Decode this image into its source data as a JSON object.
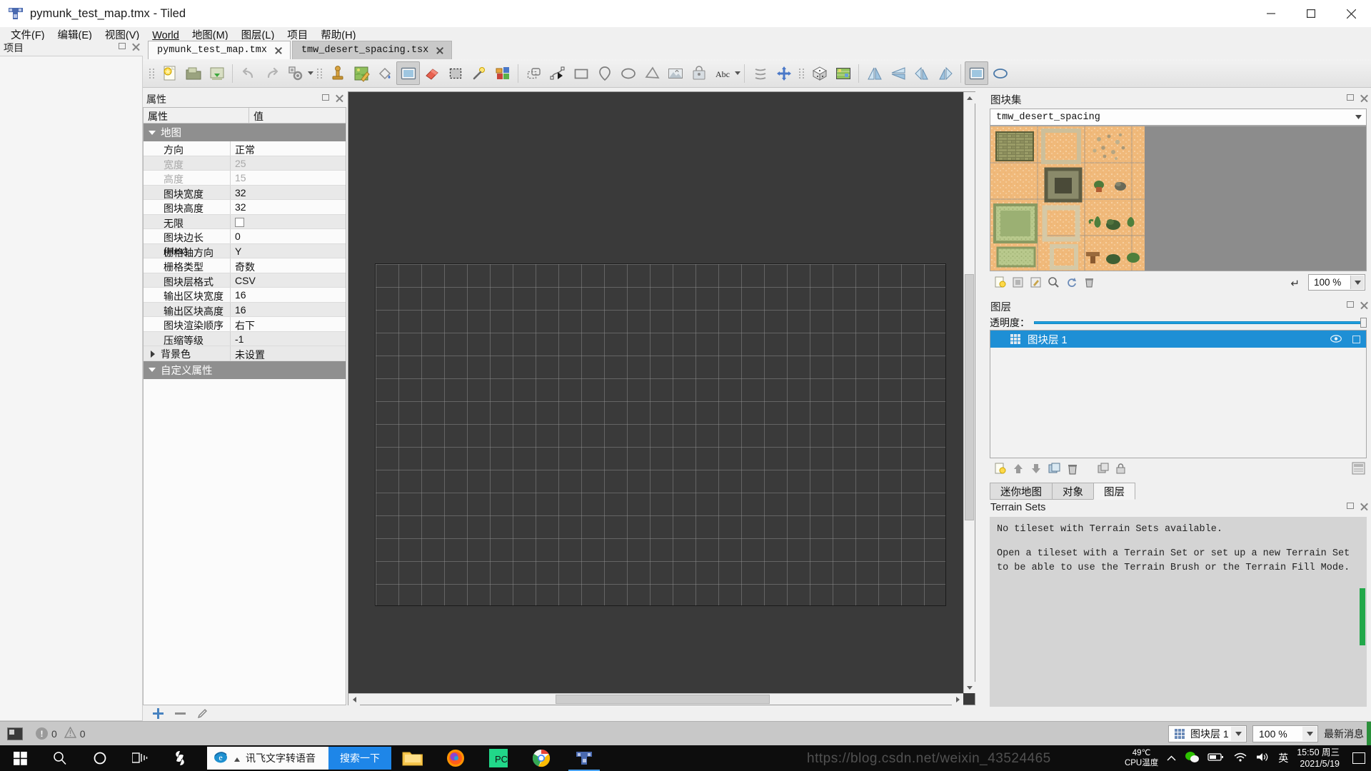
{
  "window": {
    "title": "pymunk_test_map.tmx - Tiled",
    "app_icon": "tiled-logo-icon",
    "minimize": "—",
    "maximize": "□",
    "close": "✕"
  },
  "menubar": {
    "items": [
      {
        "label": "文件(F)",
        "mnemonic": "F"
      },
      {
        "label": "编辑(E)",
        "mnemonic": "E"
      },
      {
        "label": "视图(V)",
        "mnemonic": "V"
      },
      {
        "label": "World",
        "mnemonic": "W"
      },
      {
        "label": "地图(M)",
        "mnemonic": "M"
      },
      {
        "label": "图层(L)",
        "mnemonic": "L"
      },
      {
        "label": "项目",
        "mnemonic": ""
      },
      {
        "label": "帮助(H)",
        "mnemonic": "H"
      }
    ]
  },
  "project_dock": {
    "title": "项目"
  },
  "tabs": [
    {
      "label": "pymunk_test_map.tmx",
      "active": true
    },
    {
      "label": "tmw_desert_spacing.tsx",
      "active": false
    }
  ],
  "toolbar": {
    "buttons": [
      {
        "name": "new-map-button",
        "icon": "new-file-icon"
      },
      {
        "name": "open-file-button",
        "icon": "open-folder-icon"
      },
      {
        "name": "save-file-button",
        "icon": "save-disk-icon"
      },
      {
        "name": "undo-button",
        "icon": "undo-arrow-icon"
      },
      {
        "name": "redo-button",
        "icon": "redo-arrow-icon"
      },
      {
        "name": "object-types-button",
        "icon": "gear-objects-icon"
      },
      {
        "name": "stamp-brush-button",
        "icon": "stamp-icon"
      },
      {
        "name": "terrain-brush-button",
        "icon": "map-pencil-icon"
      },
      {
        "name": "bucket-fill-button",
        "icon": "paint-bucket-icon"
      },
      {
        "name": "rectangle-select-button",
        "icon": "rectangle-select-icon"
      },
      {
        "name": "eraser-button",
        "icon": "eraser-icon"
      },
      {
        "name": "select-same-tile-button",
        "icon": "dashed-rect-icon"
      },
      {
        "name": "magic-wand-button",
        "icon": "magic-wand-icon"
      },
      {
        "name": "shape-fill-button",
        "icon": "shape-fill-icon"
      },
      {
        "name": "select-objects-button",
        "icon": "object-select-icon"
      },
      {
        "name": "edit-polygons-button",
        "icon": "polygon-edit-icon"
      },
      {
        "name": "insert-rectangle-button",
        "icon": "rectangle-icon"
      },
      {
        "name": "insert-point-button",
        "icon": "point-pin-icon"
      },
      {
        "name": "insert-ellipse-button",
        "icon": "ellipse-icon"
      },
      {
        "name": "insert-polygon-button",
        "icon": "polygon-icon"
      },
      {
        "name": "insert-tile-button",
        "icon": "image-tile-icon"
      },
      {
        "name": "insert-template-button",
        "icon": "template-icon"
      },
      {
        "name": "insert-text-button",
        "icon": "text-abc-icon"
      },
      {
        "name": "random-mode-button",
        "icon": "dice-icon"
      },
      {
        "name": "pan-tool-button",
        "icon": "move-cross-icon"
      },
      {
        "name": "dice-random-button",
        "icon": "dice-3d-icon"
      },
      {
        "name": "minimap-button",
        "icon": "minimap-icon"
      },
      {
        "name": "flip-horizontal-button",
        "icon": "flip-horizontal-icon"
      },
      {
        "name": "flip-vertical-button",
        "icon": "flip-vertical-icon"
      },
      {
        "name": "rotate-left-button",
        "icon": "rotate-left-icon"
      },
      {
        "name": "rotate-right-button",
        "icon": "rotate-right-icon"
      },
      {
        "name": "highlight-layer-button",
        "icon": "highlight-layer-icon"
      },
      {
        "name": "show-grid-button",
        "icon": "ellipse-outline-icon"
      }
    ]
  },
  "properties": {
    "dock_title": "属性",
    "col_key": "属性",
    "col_value": "值",
    "group_map": "地图",
    "group_custom": "自定义属性",
    "rows": [
      {
        "key": "方向",
        "value": "正常",
        "dim": false,
        "type": "text"
      },
      {
        "key": "宽度",
        "value": "25",
        "dim": true,
        "type": "text"
      },
      {
        "key": "高度",
        "value": "15",
        "dim": true,
        "type": "text"
      },
      {
        "key": "图块宽度",
        "value": "32",
        "dim": false,
        "type": "text"
      },
      {
        "key": "图块高度",
        "value": "32",
        "dim": false,
        "type": "text"
      },
      {
        "key": "无限",
        "value": "",
        "dim": false,
        "type": "checkbox",
        "checked": false
      },
      {
        "key": "图块边长 (Hex)",
        "value": "0",
        "dim": false,
        "type": "text"
      },
      {
        "key": "栅格轴方向",
        "value": "Y",
        "dim": false,
        "type": "text"
      },
      {
        "key": "栅格类型",
        "value": "奇数",
        "dim": false,
        "type": "text"
      },
      {
        "key": "图块层格式",
        "value": "CSV",
        "dim": false,
        "type": "text"
      },
      {
        "key": "输出区块宽度",
        "value": "16",
        "dim": false,
        "type": "text"
      },
      {
        "key": "输出区块高度",
        "value": "16",
        "dim": false,
        "type": "text"
      },
      {
        "key": "图块渲染顺序",
        "value": "右下",
        "dim": false,
        "type": "text"
      },
      {
        "key": "压缩等级",
        "value": "-1",
        "dim": false,
        "type": "text"
      }
    ],
    "bg_color_row": {
      "key": "背景色",
      "value": "未设置"
    },
    "footer": {
      "add_property": "add-property-icon",
      "remove_property": "remove-property-icon",
      "edit_property": "edit-property-icon"
    }
  },
  "tileset_dock": {
    "title": "图块集",
    "selected_tileset": "tmw_desert_spacing",
    "zoom": "100 %",
    "reset_icon": "reset-zoom-icon",
    "tools": [
      {
        "name": "new-tileset-icon"
      },
      {
        "name": "embed-tileset-icon"
      },
      {
        "name": "edit-tileset-icon"
      },
      {
        "name": "tileset-properties-icon"
      },
      {
        "name": "refresh-tileset-icon"
      },
      {
        "name": "remove-tileset-icon"
      }
    ]
  },
  "layers_dock": {
    "title": "图层",
    "opacity_label": "透明度：",
    "opacity_value": 100,
    "layers": [
      {
        "name": "图块层 1",
        "selected": true,
        "visible": true,
        "locked": false,
        "icon": "tile-layer-icon"
      }
    ],
    "tools": [
      {
        "name": "new-layer-icon"
      },
      {
        "name": "move-layer-up-icon"
      },
      {
        "name": "move-layer-down-icon"
      },
      {
        "name": "duplicate-layer-icon"
      },
      {
        "name": "delete-layer-icon"
      },
      {
        "name": "group-layer-icon"
      },
      {
        "name": "lock-layer-icon"
      },
      {
        "name": "layer-properties-icon"
      }
    ]
  },
  "panel_tabs": [
    {
      "label": "迷你地图",
      "active": false
    },
    {
      "label": "对象",
      "active": false
    },
    {
      "label": "图层",
      "active": true
    }
  ],
  "terrain_dock": {
    "title": "Terrain Sets",
    "message_1": "No tileset with Terrain Sets available.",
    "message_2": "Open a tileset with a Terrain Set or set up a new Terrain Set to be able to use the Terrain Brush or the Terrain Fill Mode."
  },
  "statusbar": {
    "error_count": "0",
    "warning_count": "0",
    "current_layer": "图块层 1",
    "zoom": "100 %",
    "news_label": "最新消息",
    "status_icon": "console-icon"
  },
  "taskbar": {
    "start": "windows-start-icon",
    "search": "search-icon",
    "cortana": "cortana-circle-icon",
    "task_view": "task-view-icon",
    "search_box_value": "讯飞文字转语音",
    "search_button": "搜索一下",
    "apps": [
      {
        "name": "app-snipaste",
        "icon": "snipaste-icon"
      },
      {
        "name": "app-file-explorer",
        "icon": "folder-icon"
      },
      {
        "name": "app-firefox",
        "icon": "firefox-icon"
      },
      {
        "name": "app-pycharm",
        "icon": "pycharm-icon"
      },
      {
        "name": "app-chrome",
        "icon": "chrome-icon"
      },
      {
        "name": "app-tiled",
        "icon": "tiled-icon",
        "active": true
      }
    ],
    "tray": {
      "cpu_temp": "49℃",
      "cpu_label": "CPU温度",
      "ime": "英",
      "time": "15:50 周三",
      "date": "2021/5/19"
    }
  },
  "watermark": "https://blog.csdn.net/weixin_43524465",
  "colors": {
    "accent": "#1e8fd5",
    "canvas_bg": "#3a3a3a",
    "chrome": "#f0f0f0",
    "taskbar": "#0d0d0d",
    "search_button": "#1e86e8"
  }
}
